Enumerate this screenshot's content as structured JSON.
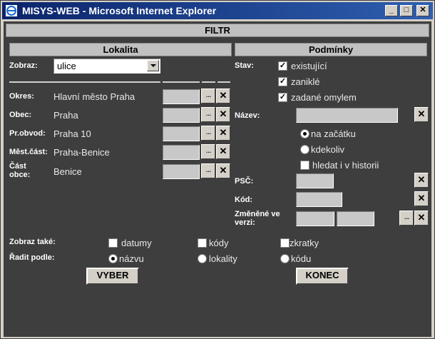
{
  "window": {
    "title": "MISYS-WEB - Microsoft Internet Explorer"
  },
  "header": {
    "title": "FILTR"
  },
  "lokalita": {
    "title": "Lokalita",
    "zobraz_label": "Zobraz:",
    "zobraz_value": "ulice",
    "rows": [
      {
        "label": "Okres:",
        "value": "Hlavní město Praha"
      },
      {
        "label": "Obec:",
        "value": "Praha"
      },
      {
        "label": "Pr.obvod:",
        "value": "Praha 10"
      },
      {
        "label": "Měst.část:",
        "value": "Praha-Benice"
      },
      {
        "label": "Část obce:",
        "value": "Benice"
      }
    ],
    "dots_label": "...",
    "x_label": "✕"
  },
  "podminky": {
    "title": "Podmínky",
    "stav_label": "Stav:",
    "stav_options": [
      {
        "label": "existující",
        "checked": true
      },
      {
        "label": "zaniklé",
        "checked": true
      },
      {
        "label": "zadané omylem",
        "checked": true
      }
    ],
    "nazev_label": "Název:",
    "nazev_value": "",
    "radio_options": [
      {
        "label": "na začátku",
        "selected": true
      },
      {
        "label": "kdekoliv",
        "selected": false
      }
    ],
    "historie": {
      "label": "hledat i v historii",
      "checked": false
    },
    "psc_label": "PSČ:",
    "kod_label": "Kód:",
    "zmenene_label": "Změněné ve verzi:"
  },
  "footer": {
    "zobraz_take_label": "Zobraz také:",
    "zobraz_take": [
      {
        "label": "datumy",
        "checked": false
      },
      {
        "label": "kódy",
        "checked": false
      },
      {
        "label": "zkratky",
        "checked": false
      }
    ],
    "radit_label": "Řadit podle:",
    "radit": [
      {
        "label": "názvu",
        "selected": true
      },
      {
        "label": "lokality",
        "selected": false
      },
      {
        "label": "kódu",
        "selected": false
      }
    ],
    "vyber_label": "VYBER",
    "konec_label": "KONEC"
  },
  "colors": {
    "titlebar": "#0a246a",
    "content_bg": "#3e3e3e",
    "bar_bg": "#c0c0c0",
    "field_bg": "#c8c8c8"
  }
}
